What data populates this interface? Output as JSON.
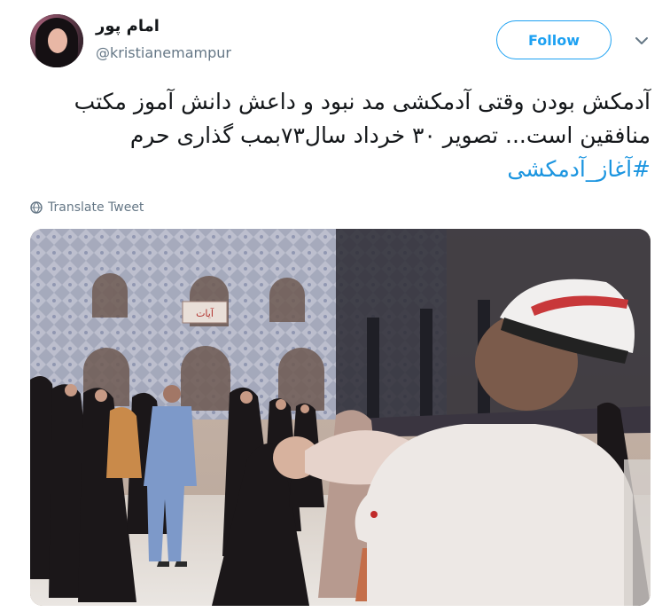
{
  "author": {
    "display_name": "امام پور",
    "handle": "@kristianemampur"
  },
  "actions": {
    "follow_label": "Follow"
  },
  "tweet": {
    "text": "آدمکش بودن وقتی آدمکشی مد نبود و داعش دانش آموز مکتب منافقین است... تصویر ۳۰ خرداد سال۷۳بمب گذاری حرم",
    "hashtag": "#آغاز_آدمکشی"
  },
  "translate_label": "Translate Tweet",
  "photo": {
    "banner_text": "آيات"
  },
  "colors": {
    "accent": "#1da1f2",
    "link": "#1b95e0",
    "text": "#14171a",
    "muted": "#657786"
  },
  "icons": [
    "chevron-down-icon",
    "globe-icon"
  ]
}
